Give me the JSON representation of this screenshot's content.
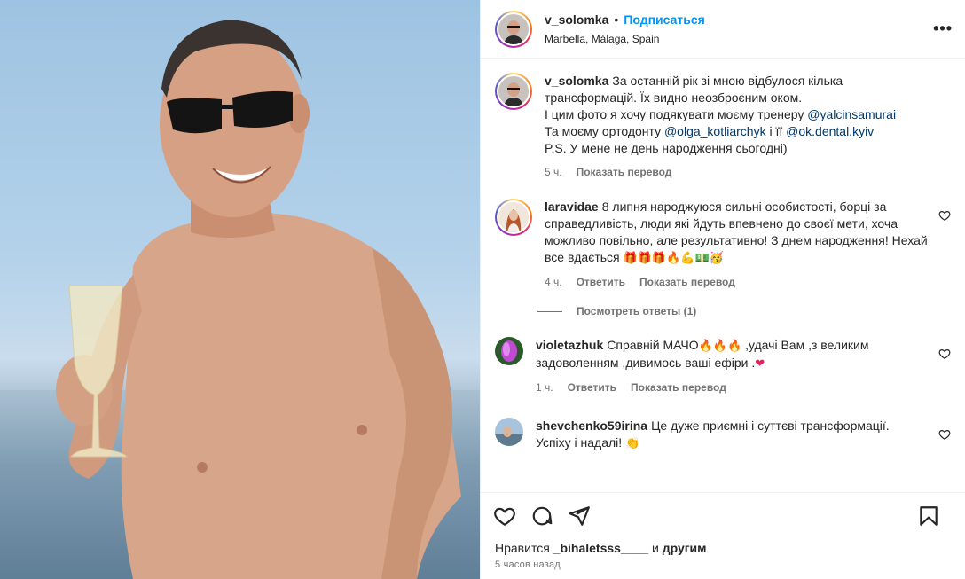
{
  "post": {
    "username": "v_solomka",
    "follow_label": "Подписаться",
    "location": "Marbella, Málaga, Spain",
    "more_label": "•••"
  },
  "caption": {
    "username": "v_solomka",
    "line1": "За останній рік зі мною відбулося кілька трансформацій. Їх видно неозброєним оком.",
    "line2": "І цим фото я хочу подякувати моєму тренеру ",
    "mention1": "@yalcinsamurai",
    "line3": "Та моєму ортодонту ",
    "mention2": "@olga_kotliarchyk",
    "line3b": " і її ",
    "mention3": "@ok.dental.kyiv",
    "line4": "P.S. У мене не день народження сьогодні)",
    "time": "5 ч.",
    "translate": "Показать перевод"
  },
  "comments": [
    {
      "username": "laravidae",
      "text": "8 липня народжуюся сильні особистості, борці за справедливість, люди які йдуть впевнено до своєї мети, хоча можливо повільно, але результативно! З днем народження! Нехай все вдається ",
      "emoji": "🎁🎁🎁🔥💪💵🥳",
      "time": "4 ч.",
      "reply": "Ответить",
      "translate": "Показать перевод",
      "view_replies": "Посмотреть ответы (1)"
    },
    {
      "username": "violetazhuk",
      "text_a": "Справній МАЧО",
      "emoji_a": "🔥🔥🔥",
      "text_b": " ,удачі Вам ,з великим задоволенням ,дивимось ваші ефіри .",
      "emoji_b": "❤",
      "time": "1 ч.",
      "reply": "Ответить",
      "translate": "Показать перевод"
    },
    {
      "username": "shevchenko59irina",
      "text": "Це дуже приємні і суттєві трансформації. Успіху і надалі! ",
      "emoji": "👏"
    }
  ],
  "likes": {
    "prefix": "Нравится ",
    "user": "_bihaletsss____",
    "middle": " и ",
    "others": "другим"
  },
  "timestamp": "5 часов назад",
  "colors": {
    "accent": "#0095f6",
    "mention": "#00376b",
    "muted": "#737373"
  }
}
